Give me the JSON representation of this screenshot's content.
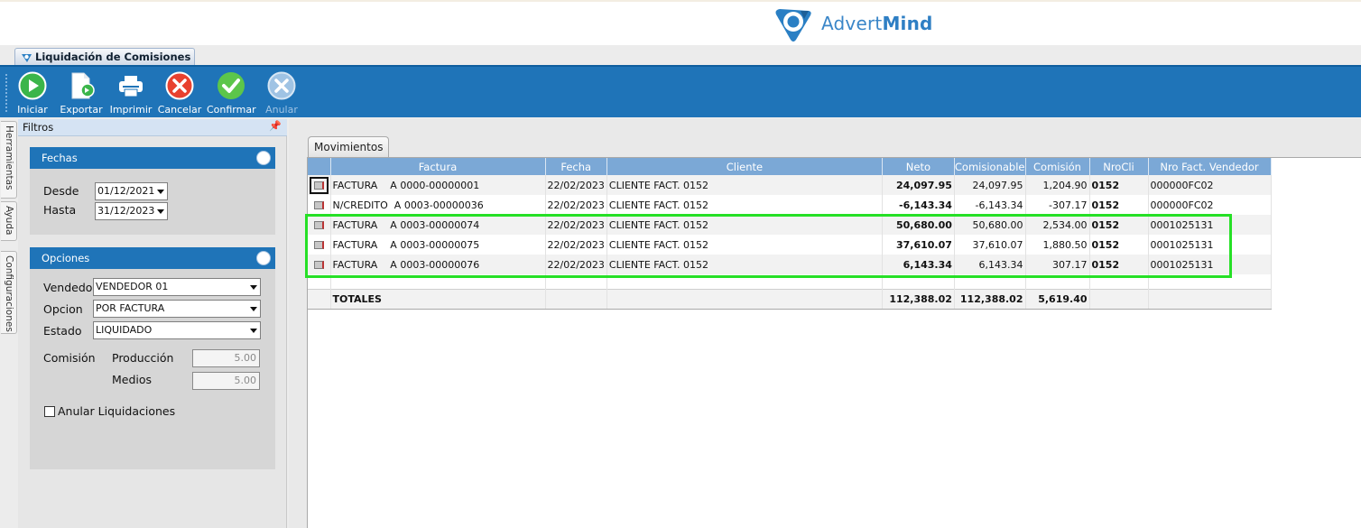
{
  "app": {
    "brand_light": "Advert",
    "brand_bold": "Mind",
    "document_tab": "Liquidación de Comisiones"
  },
  "toolbar": {
    "buttons": [
      {
        "label": "Iniciar",
        "icon": "play-icon",
        "enabled": true
      },
      {
        "label": "Exportar",
        "icon": "export-icon",
        "enabled": true
      },
      {
        "label": "Imprimir",
        "icon": "printer-icon",
        "enabled": true
      },
      {
        "label": "Cancelar",
        "icon": "cancel-icon",
        "enabled": true
      },
      {
        "label": "Confirmar",
        "icon": "check-icon",
        "enabled": true
      },
      {
        "label": "Anular",
        "icon": "void-icon",
        "enabled": false
      }
    ]
  },
  "side_tabs": [
    "Herramientas",
    "Ayuda",
    "Configuraciones"
  ],
  "filtros": {
    "title": "Filtros",
    "fechas": {
      "title": "Fechas",
      "desde_label": "Desde",
      "desde_value": "01/12/2021",
      "hasta_label": "Hasta",
      "hasta_value": "31/12/2023"
    },
    "opciones": {
      "title": "Opciones",
      "vendedor_label": "Vendedor",
      "vendedor_value": "VENDEDOR 01",
      "opcion_label": "Opcion",
      "opcion_value": "POR FACTURA",
      "estado_label": "Estado",
      "estado_value": "LIQUIDADO",
      "comision_label": "Comisión",
      "produccion_label": "Producción",
      "produccion_value": "5.00",
      "medios_label": "Medios",
      "medios_value": "5.00",
      "anular_label": "Anular Liquidaciones",
      "anular_checked": false
    }
  },
  "movimientos": {
    "tab_label": "Movimientos",
    "columns": [
      "Factura",
      "Fecha",
      "Cliente",
      "Neto",
      "Comisionable",
      "Comisión",
      "NroCli",
      "Nro Fact. Vendedor"
    ],
    "rows": [
      {
        "factura": "FACTURA    A 0000-00000001",
        "fecha": "22/02/2023",
        "cliente": "CLIENTE FACT. 0152",
        "neto": "24,097.95",
        "comisionable": "24,097.95",
        "comision": "1,204.90",
        "nrocli": "0152",
        "nrofact": "000000FC02"
      },
      {
        "factura": "N/CREDITO  A 0003-00000036",
        "fecha": "22/02/2023",
        "cliente": "CLIENTE FACT. 0152",
        "neto": "-6,143.34",
        "comisionable": "-6,143.34",
        "comision": "-307.17",
        "nrocli": "0152",
        "nrofact": "000000FC02"
      },
      {
        "factura": "FACTURA    A 0003-00000074",
        "fecha": "22/02/2023",
        "cliente": "CLIENTE FACT. 0152",
        "neto": "50,680.00",
        "comisionable": "50,680.00",
        "comision": "2,534.00",
        "nrocli": "0152",
        "nrofact": "0001025131"
      },
      {
        "factura": "FACTURA    A 0003-00000075",
        "fecha": "22/02/2023",
        "cliente": "CLIENTE FACT. 0152",
        "neto": "37,610.07",
        "comisionable": "37,610.07",
        "comision": "1,880.50",
        "nrocli": "0152",
        "nrofact": "0001025131"
      },
      {
        "factura": "FACTURA    A 0003-00000076",
        "fecha": "22/02/2023",
        "cliente": "CLIENTE FACT. 0152",
        "neto": "6,143.34",
        "comisionable": "6,143.34",
        "comision": "307.17",
        "nrocli": "0152",
        "nrofact": "0001025131"
      }
    ],
    "totals": {
      "label": "TOTALES",
      "neto": "112,388.02",
      "comisionable": "112,388.02",
      "comision": "5,619.40"
    }
  },
  "colors": {
    "toolbar_blue": "#1f74b8",
    "grid_header": "#7ba8d6",
    "highlight_green": "#26e026"
  }
}
